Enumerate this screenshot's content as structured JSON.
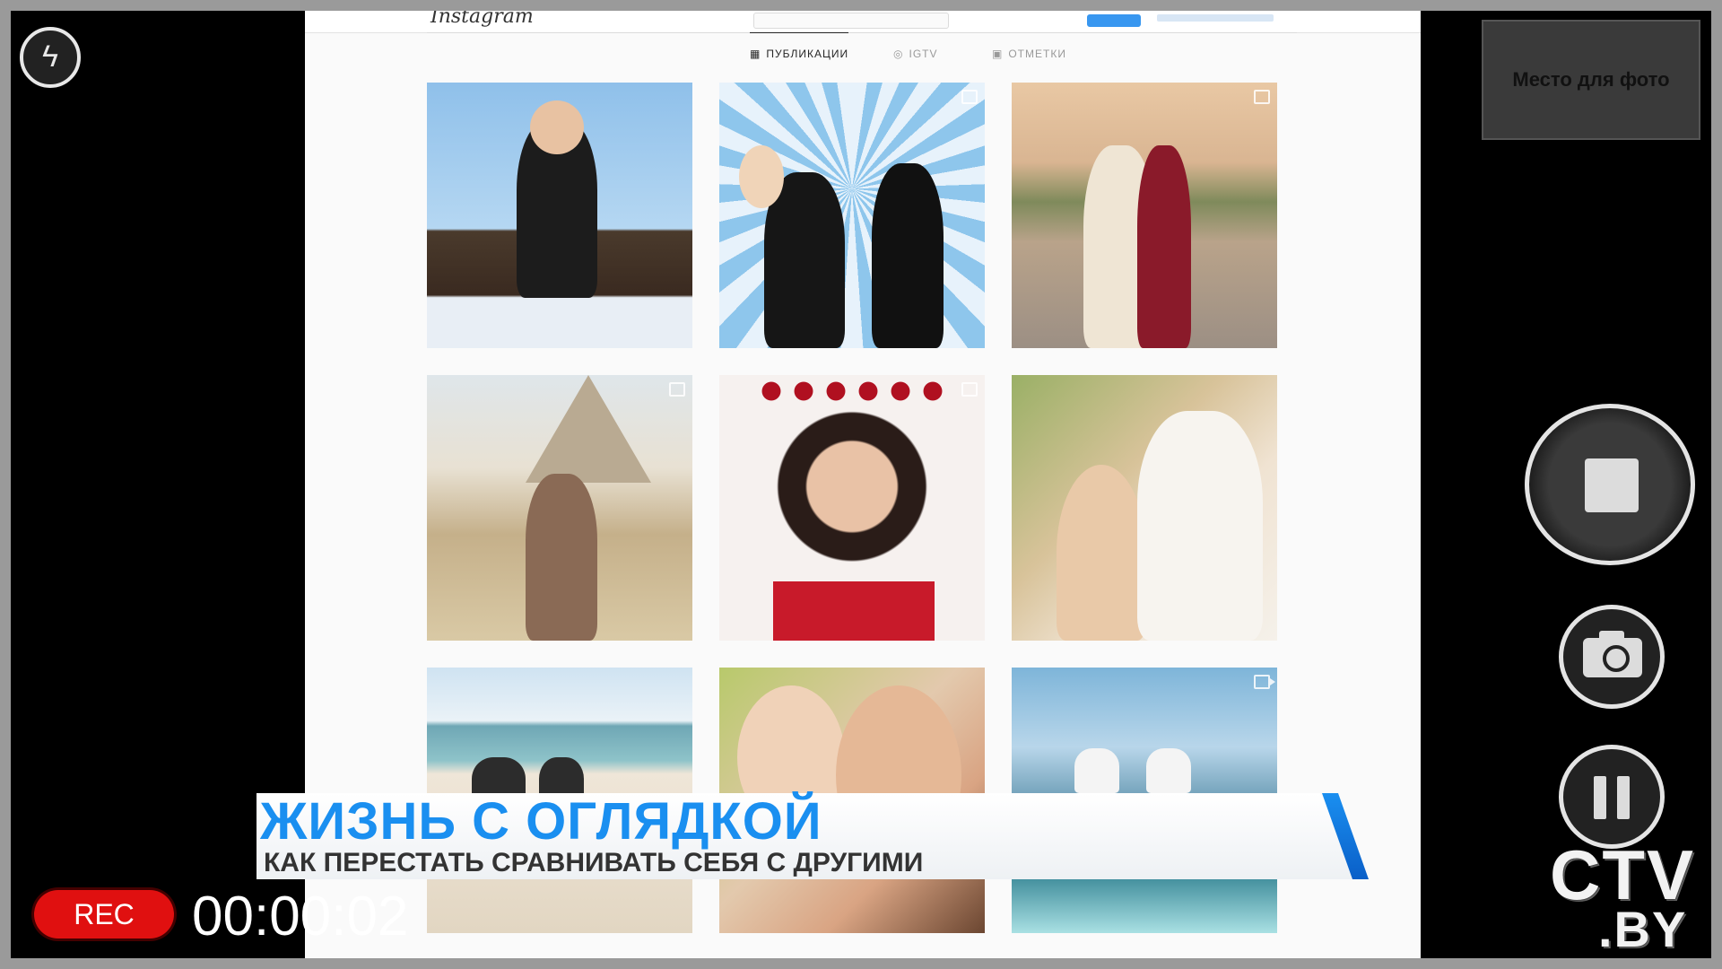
{
  "instagram": {
    "logo_text": "Instagram",
    "tabs": [
      {
        "label": "ПУБЛИКАЦИИ",
        "icon": "grid-icon",
        "active": true
      },
      {
        "label": "IGTV",
        "icon": "igtv-icon",
        "active": false
      },
      {
        "label": "ОТМЕТКИ",
        "icon": "tagged-icon",
        "active": false
      }
    ],
    "photos": [
      {
        "subject": "baby-in-suit"
      },
      {
        "subject": "family-boss-baby-party",
        "badge": "multi"
      },
      {
        "subject": "couple-at-resort",
        "badge": "multi"
      },
      {
        "subject": "couple-at-pyramids",
        "badge": "multi"
      },
      {
        "subject": "woman-with-roses",
        "badge": "multi"
      },
      {
        "subject": "mother-and-daughter"
      },
      {
        "subject": "couple-on-beach"
      },
      {
        "subject": "mother-and-baby"
      },
      {
        "subject": "couple-at-sea",
        "badge": "video"
      }
    ]
  },
  "camera": {
    "flash_icon": "flash-icon",
    "photo_placeholder": "Место для фото",
    "rec_label": "REC",
    "timer": "00:00:02",
    "rec_color": "#e01010"
  },
  "ticker": {
    "headline": "ЖИЗНЬ С ОГЛЯДКОЙ",
    "subline": "КАК ПЕРЕСТАТЬ СРАВНИВАТЬ СЕБЯ С ДРУГИМИ",
    "accent_color": "#1a8ff0"
  },
  "channel_logo": {
    "line1": "CTV",
    "line2": ".BY"
  }
}
